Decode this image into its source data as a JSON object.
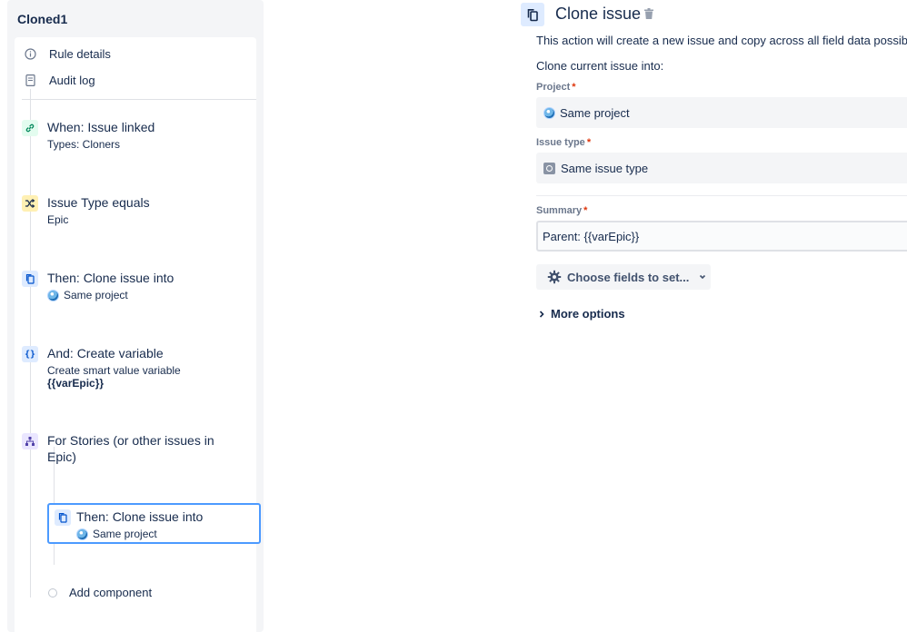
{
  "rule": {
    "title": "Cloned1",
    "menu": [
      {
        "label": "Rule details",
        "icon": "info-icon"
      },
      {
        "label": "Audit log",
        "icon": "document-icon"
      }
    ],
    "steps": [
      {
        "title": "When: Issue linked",
        "subtitle": "Types: Cloners",
        "icon": "link-icon"
      },
      {
        "title": "Issue Type equals",
        "subtitle": "Epic",
        "icon": "shuffle-icon"
      },
      {
        "title": "Then: Clone issue into",
        "subtitle": "Same project",
        "icon": "copy-icon"
      },
      {
        "title": "And: Create variable",
        "subtitle": "Create smart value variable",
        "subtitle2": "{{varEpic}}",
        "icon": "braces-icon"
      },
      {
        "title": "For Stories (or other issues in",
        "title2": "Epic)",
        "icon": "hierarchy-icon"
      }
    ],
    "branch_step": {
      "title": "Then: Clone issue into",
      "subtitle": "Same project",
      "icon": "copy-icon"
    },
    "add_component": "Add component"
  },
  "detail": {
    "title": "Clone issue",
    "description": "This action will create a new issue and copy across all field data possible.",
    "clone_into": "Clone current issue into:",
    "project": {
      "label": "Project",
      "value": "Same project"
    },
    "issue_type": {
      "label": "Issue type",
      "value": "Same issue type"
    },
    "summary": {
      "label": "Summary",
      "value": "Parent: {{varEpic}}"
    },
    "required_mark": "*",
    "choose_fields": "Choose fields to set...",
    "more_options": "More options"
  },
  "colors": {
    "selected_border": "#4c9aff",
    "required": "#de350b",
    "accent_blue": "#0052cc"
  }
}
